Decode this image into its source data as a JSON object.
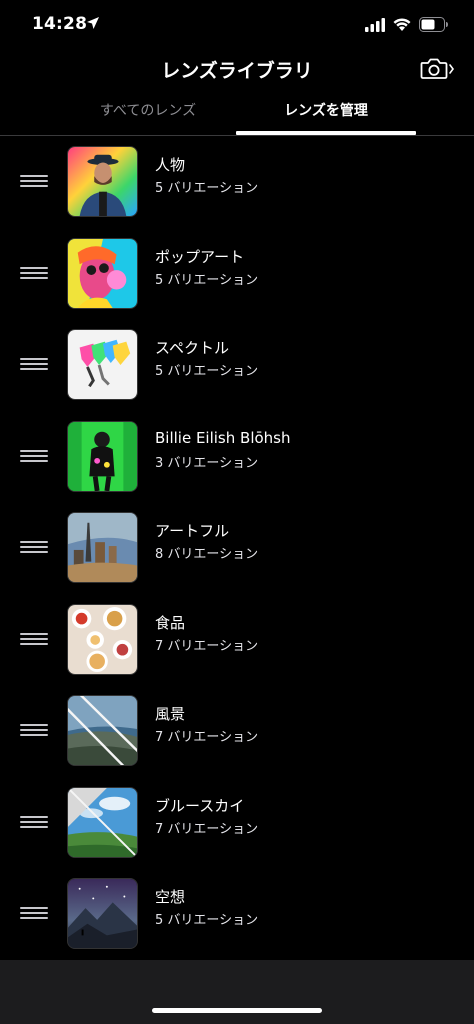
{
  "status": {
    "time": "14:28"
  },
  "header": {
    "title": "レンズライブラリ",
    "camera_icon": "camera-icon"
  },
  "tabs": [
    {
      "label": "すべてのレンズ",
      "active": false
    },
    {
      "label": "レンズを管理",
      "active": true
    }
  ],
  "lenses": [
    {
      "name": "人物",
      "count": "5 バリエーション",
      "thumb": "portrait"
    },
    {
      "name": "ポップアート",
      "count": "5 バリエーション",
      "thumb": "popart"
    },
    {
      "name": "スペクトル",
      "count": "5 バリエーション",
      "thumb": "spectrum"
    },
    {
      "name": "Billie Eilish Blōhsh",
      "count": "3 バリエーション",
      "thumb": "billie"
    },
    {
      "name": "アートフル",
      "count": "8 バリエーション",
      "thumb": "artful"
    },
    {
      "name": "食品",
      "count": "7 バリエーション",
      "thumb": "food"
    },
    {
      "name": "風景",
      "count": "7 バリエーション",
      "thumb": "landscape"
    },
    {
      "name": "ブルースカイ",
      "count": "7 バリエーション",
      "thumb": "bluesky"
    },
    {
      "name": "空想",
      "count": "5 バリエーション",
      "thumb": "fantasy"
    }
  ]
}
